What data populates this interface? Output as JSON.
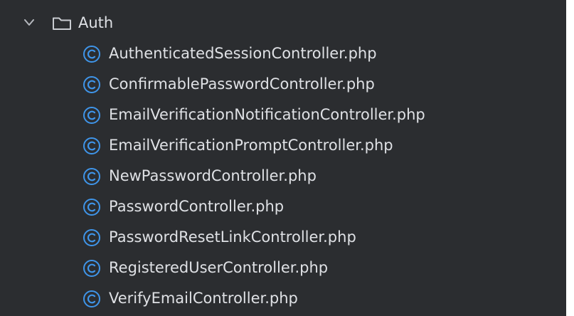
{
  "project_tree": {
    "folder": {
      "name": "Auth",
      "expanded": true,
      "icons": {
        "chevron": "chevron-down-icon",
        "folder": "folder-icon"
      }
    },
    "files": [
      {
        "name": "AuthenticatedSessionController.php",
        "icon": "php-class-icon"
      },
      {
        "name": "ConfirmablePasswordController.php",
        "icon": "php-class-icon"
      },
      {
        "name": "EmailVerificationNotificationController.php",
        "icon": "php-class-icon"
      },
      {
        "name": "EmailVerificationPromptController.php",
        "icon": "php-class-icon"
      },
      {
        "name": "NewPasswordController.php",
        "icon": "php-class-icon"
      },
      {
        "name": "PasswordController.php",
        "icon": "php-class-icon"
      },
      {
        "name": "PasswordResetLinkController.php",
        "icon": "php-class-icon"
      },
      {
        "name": "RegisteredUserController.php",
        "icon": "php-class-icon"
      },
      {
        "name": "VerifyEmailController.php",
        "icon": "php-class-icon"
      }
    ]
  },
  "colors": {
    "panel_background": "#2b2d30",
    "text": "#dfe1e5",
    "class_icon": "#3f95e9"
  }
}
